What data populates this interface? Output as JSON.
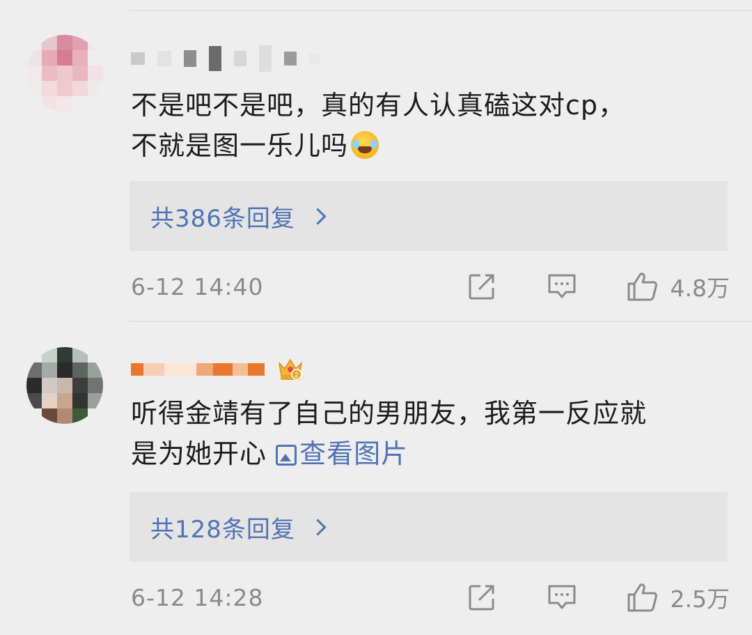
{
  "comments": [
    {
      "text_line1": "不是吧不是吧，真的有人认真磕这对cp，",
      "text_line2": "不就是图一乐儿吗",
      "emoji": "laugh-cry-icon",
      "reply_label": "共386条回复",
      "time": "6-12 14:40",
      "likes": "4.8万"
    },
    {
      "text_line1": "听得金靖有了自己的男朋友，我第一反应就",
      "text_line2": "是为她开心",
      "image_link_label": "查看图片",
      "reply_label": "共128条回复",
      "time": "6-12 14:28",
      "likes": "2.5万"
    }
  ],
  "icons": {
    "share": "share-icon",
    "comment": "comment-icon",
    "like": "thumbs-up-icon",
    "chevron": "chevron-right-icon",
    "badge": "crown-badge-icon"
  },
  "colors": {
    "background": "#eeeeee",
    "reply_box": "#e4e4e4",
    "link_blue": "#4f73b4",
    "meta_gray": "#8a8a8a",
    "username_orange": "#e9782e"
  }
}
